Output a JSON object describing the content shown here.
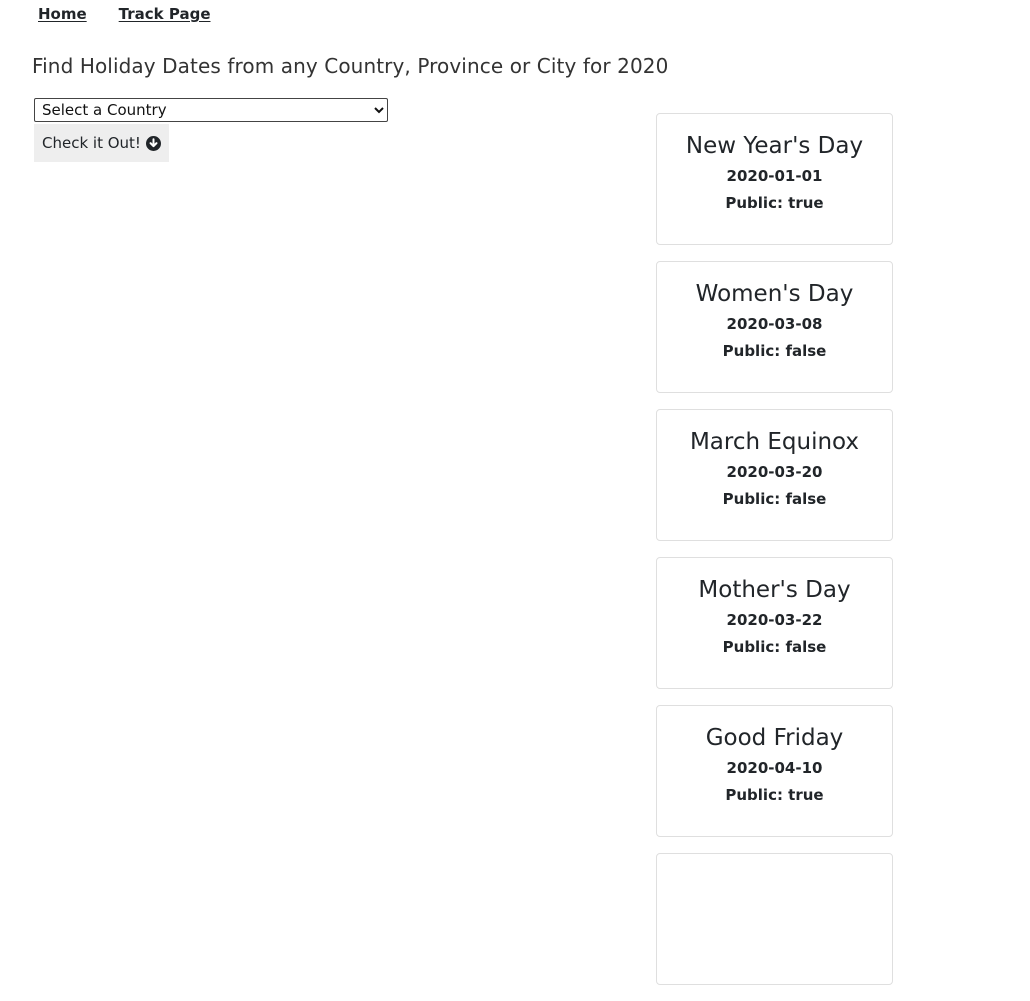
{
  "nav": {
    "home": "Home",
    "track": "Track Page"
  },
  "headline": "Find Holiday Dates from any Country, Province or City for 2020",
  "country_select": {
    "selected": "Select a Country"
  },
  "check_button": {
    "label": "Check it Out!",
    "icon": "arrow-circle-down-icon"
  },
  "holidays": [
    {
      "name": "New Year's Day",
      "date": "2020-01-01",
      "public": "Public: true"
    },
    {
      "name": "Women's Day",
      "date": "2020-03-08",
      "public": "Public: false"
    },
    {
      "name": "March Equinox",
      "date": "2020-03-20",
      "public": "Public: false"
    },
    {
      "name": "Mother's Day",
      "date": "2020-03-22",
      "public": "Public: false"
    },
    {
      "name": "Good Friday",
      "date": "2020-04-10",
      "public": "Public: true"
    },
    {
      "name": "",
      "date": "",
      "public": ""
    }
  ]
}
